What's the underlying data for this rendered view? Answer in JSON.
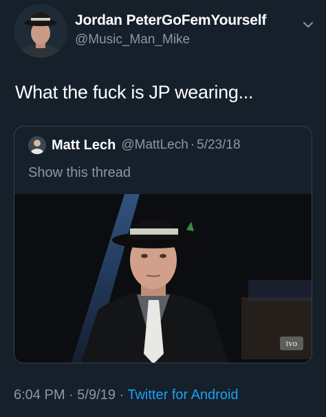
{
  "author": {
    "display_name": "Jordan PeterGoFemYourself",
    "handle": "@Music_Man_Mike"
  },
  "tweet": {
    "text": "What the fuck is JP wearing..."
  },
  "quoted_tweet": {
    "display_name": "Matt Lech",
    "handle": "@MattLech",
    "separator": "·",
    "date": "5/23/18",
    "show_thread_label": "Show this thread",
    "media_watermark": "tvo"
  },
  "meta": {
    "time": "6:04 PM",
    "separator_1": "·",
    "date": "5/9/19",
    "separator_2": "·",
    "source": "Twitter for Android"
  },
  "icons": {
    "more": "chevron-down-icon"
  },
  "colors": {
    "background": "#15202b",
    "secondary_text": "#8899a6",
    "link": "#1da1f2",
    "border": "#38444d"
  }
}
